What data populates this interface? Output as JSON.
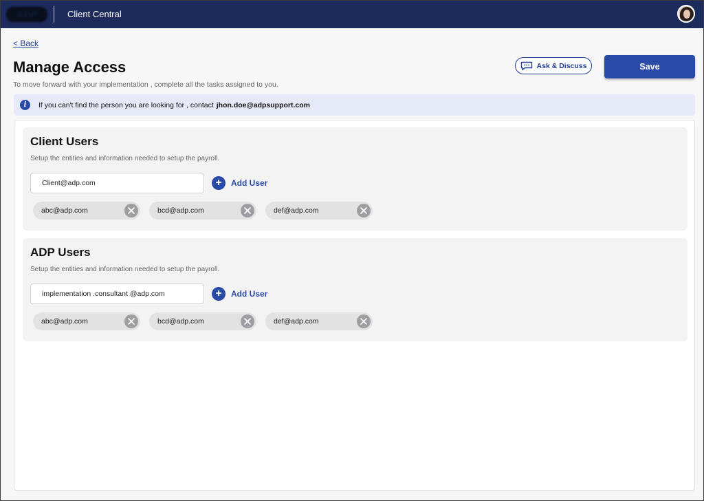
{
  "header": {
    "app_title": "Client Central",
    "logo_text": "ADP"
  },
  "nav": {
    "back_label": "< Back"
  },
  "page": {
    "title": "Manage Access",
    "subtitle": "To move forward with your implementation , complete all the tasks assigned to you."
  },
  "actions": {
    "ask_label": "Ask & Discuss",
    "save_label": "Save"
  },
  "info": {
    "text": "If you can't find the person you are looking for , contact",
    "email": "jhon.doe@adpsupport.com"
  },
  "sections": [
    {
      "title": "Client Users",
      "description": "Setup the entities and information needed to setup the payroll.",
      "input_value": "Client@adp.com",
      "add_label": "Add User",
      "chips": [
        "abc@adp.com",
        "bcd@adp.com",
        "def@adp.com"
      ]
    },
    {
      "title": "ADP Users",
      "description": "Setup the entities and information needed to setup the payroll.",
      "input_value": "implementation .consultant @adp.com",
      "add_label": "Add User",
      "chips": [
        "abc@adp.com",
        "bcd@adp.com",
        "def@adp.com"
      ]
    }
  ],
  "colors": {
    "brand_navy": "#1c2a5c",
    "primary": "#2a4aa7",
    "info_bg": "#e6e9f7"
  },
  "icons": {
    "info": "info-icon",
    "ask": "chat-bubble-icon",
    "add": "plus-circle-icon",
    "remove": "close-circle-icon"
  }
}
